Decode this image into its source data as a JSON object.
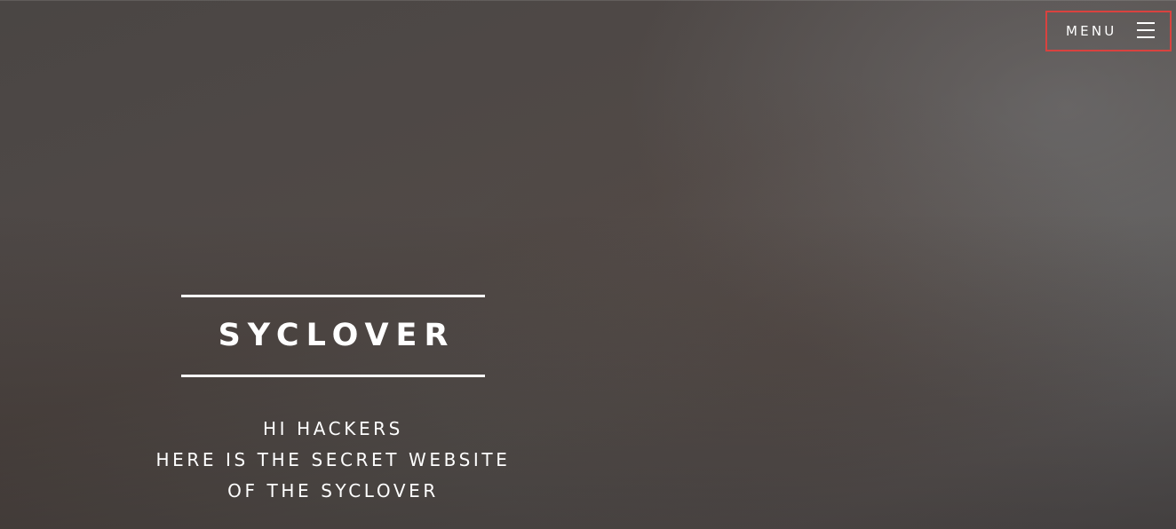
{
  "header": {
    "menu_label": "MENU",
    "menu_icon": "hamburger-icon",
    "menu_border_color": "#d9423f"
  },
  "hero": {
    "title": "SYCLOVER",
    "tagline": [
      "HI HACKERS",
      "HERE IS THE SECRET WEBSITE",
      "OF THE SYCLOVER"
    ]
  },
  "colors": {
    "text": "#ffffff",
    "background": "#514a47"
  }
}
